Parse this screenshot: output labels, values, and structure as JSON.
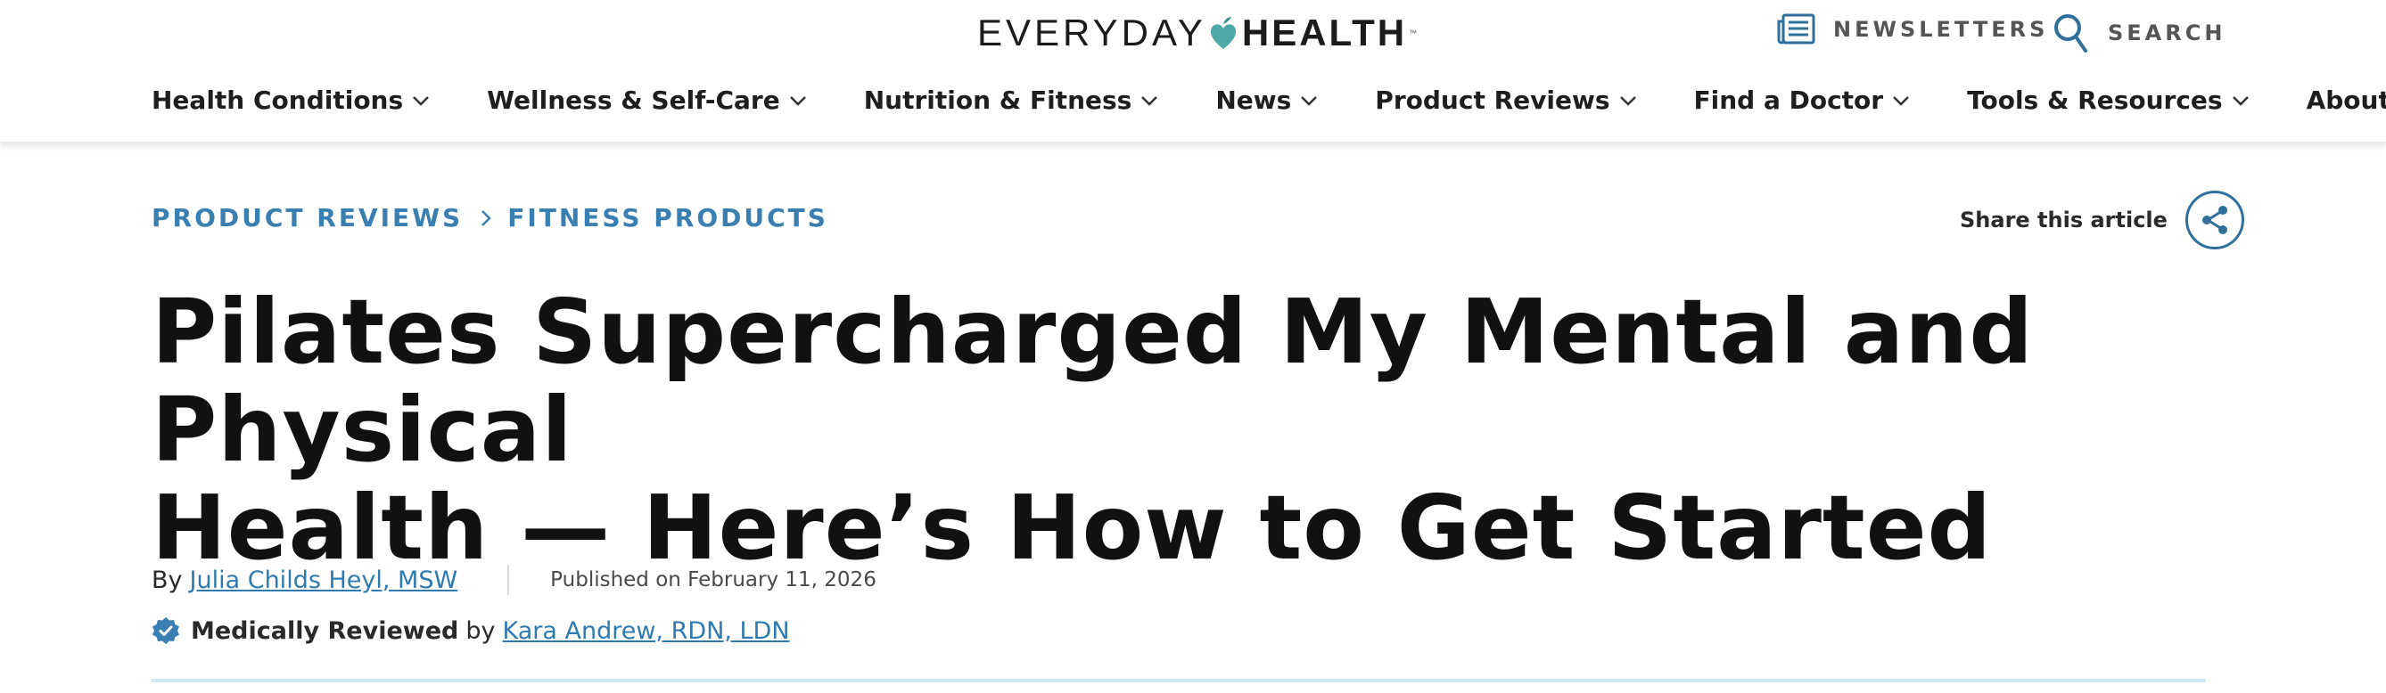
{
  "brand": {
    "logo_left": "EVERYDAY",
    "logo_right": "HEALTH",
    "trademark": "™",
    "heart_color": "#4fa8a6"
  },
  "utility": {
    "newsletters_label": "NEWSLETTERS",
    "search_label": "SEARCH",
    "icon_color": "#2f6f9a"
  },
  "nav": {
    "items": [
      {
        "label": "Health Conditions"
      },
      {
        "label": "Wellness & Self-Care"
      },
      {
        "label": "Nutrition & Fitness"
      },
      {
        "label": "News"
      },
      {
        "label": "Product Reviews"
      },
      {
        "label": "Find a Doctor"
      },
      {
        "label": "Tools & Resources"
      },
      {
        "label": "About Us"
      }
    ]
  },
  "breadcrumb": {
    "items": [
      {
        "label": "PRODUCT REVIEWS"
      },
      {
        "label": "FITNESS PRODUCTS"
      }
    ],
    "color": "#3a7fb2"
  },
  "share": {
    "label": "Share this article"
  },
  "article": {
    "title_line_1": "Pilates Supercharged My Mental and Physical",
    "title_line_2": "Health — Here’s How to Get Started",
    "byline": {
      "prefix": "By",
      "author": "Julia Childs Heyl, MSW",
      "published": "Published on February 11, 2026"
    },
    "review": {
      "label": "Medically Reviewed",
      "by": "by",
      "reviewer": "Kara Andrew, RDN, LDN"
    }
  },
  "icons": {
    "newsletters": "newspaper-icon",
    "search": "search-icon",
    "nav_chevron": "chevron-down-icon",
    "breadcrumb_separator": "chevron-right-icon",
    "share": "share-icon",
    "review_badge": "verified-badge-icon"
  }
}
